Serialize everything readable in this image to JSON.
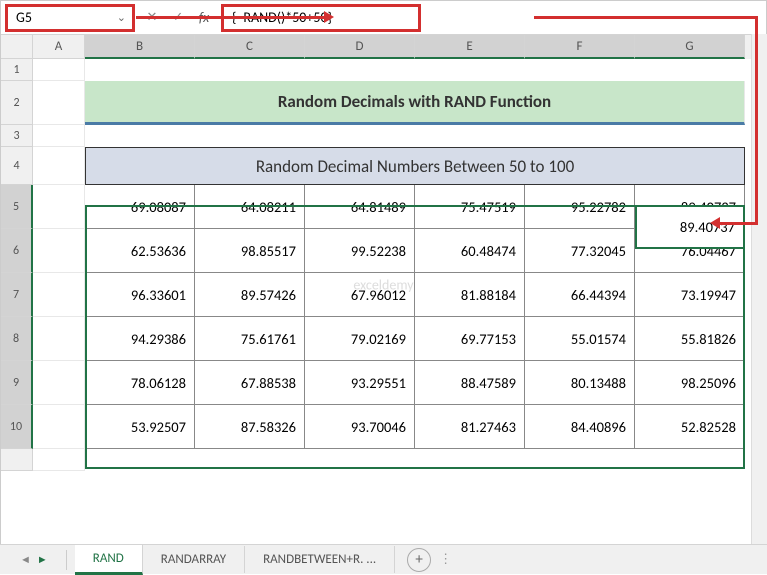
{
  "cell_ref": "G5",
  "formula": "{=RAND()*50+50}",
  "columns": [
    "A",
    "B",
    "C",
    "D",
    "E",
    "F",
    "G"
  ],
  "title": "Random Decimals with RAND Function",
  "subtitle": "Random Decimal Numbers Between 50 to 100",
  "watermark": "exceldemy",
  "rows": [
    [
      "69.08087",
      "64.08211",
      "64.81489",
      "75.47519",
      "95.22782",
      "89.40737"
    ],
    [
      "62.53636",
      "98.85517",
      "99.52238",
      "60.48474",
      "77.32045",
      "76.04467"
    ],
    [
      "96.33601",
      "89.57426",
      "67.96012",
      "81.88184",
      "66.44394",
      "73.19947"
    ],
    [
      "94.29386",
      "75.61761",
      "79.02169",
      "69.77153",
      "55.01574",
      "55.81826"
    ],
    [
      "78.06128",
      "67.88538",
      "93.29551",
      "88.47589",
      "80.13488",
      "98.25096"
    ],
    [
      "53.92507",
      "87.58326",
      "93.70046",
      "81.27463",
      "84.40896",
      "52.82528"
    ]
  ],
  "tabs": {
    "active": "RAND",
    "others": [
      "RANDARRAY",
      "RANDBETWEEN+R. ..."
    ]
  },
  "chart_data": {
    "type": "table",
    "title": "Random Decimal Numbers Between 50 to 100",
    "columns": [
      "B",
      "C",
      "D",
      "E",
      "F",
      "G"
    ],
    "row_labels": [
      5,
      6,
      7,
      8,
      9,
      10
    ],
    "values": [
      [
        69.08087,
        64.08211,
        64.81489,
        75.47519,
        95.22782,
        89.40737
      ],
      [
        62.53636,
        98.85517,
        99.52238,
        60.48474,
        77.32045,
        76.04467
      ],
      [
        96.33601,
        89.57426,
        67.96012,
        81.88184,
        66.44394,
        73.19947
      ],
      [
        94.29386,
        75.61761,
        79.02169,
        69.77153,
        55.01574,
        55.81826
      ],
      [
        78.06128,
        67.88538,
        93.29551,
        88.47589,
        80.13488,
        98.25096
      ],
      [
        53.92507,
        87.58326,
        93.70046,
        81.27463,
        84.40896,
        52.82528
      ]
    ]
  }
}
